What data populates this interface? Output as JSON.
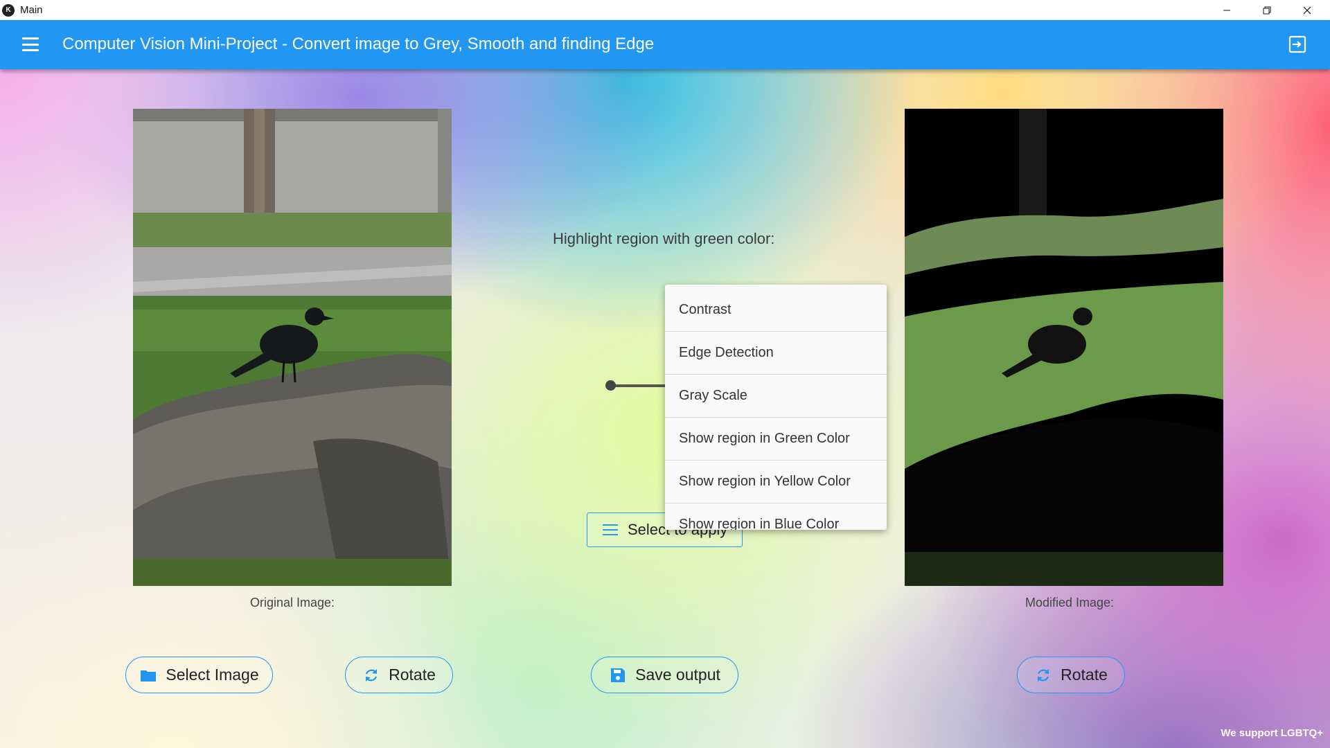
{
  "window": {
    "title": "Main"
  },
  "appbar": {
    "title": "Computer Vision Mini-Project - Convert image to Grey, Smooth and finding Edge"
  },
  "main": {
    "highlight_label": "Highlight region with green color:",
    "original_caption": "Original Image:",
    "modified_caption": "Modified Image:",
    "select_apply_label": "Select to apply",
    "dropdown_options": [
      "Contrast",
      "Edge Detection",
      "Gray Scale",
      "Show region in Green Color",
      "Show region in Yellow Color",
      "Show region in Blue Color"
    ]
  },
  "buttons": {
    "select_image": "Select Image",
    "rotate_left": "Rotate",
    "save_output": "Save output",
    "rotate_right": "Rotate"
  },
  "footer": {
    "note": "We support LGBTQ+"
  },
  "colors": {
    "accent": "#2196f3",
    "appbar": "#2196f3"
  },
  "icons": [
    "menu-icon",
    "exit-icon",
    "folder-icon",
    "rotate-icon",
    "save-icon",
    "list-icon",
    "minimize-icon",
    "restore-icon",
    "close-icon"
  ]
}
